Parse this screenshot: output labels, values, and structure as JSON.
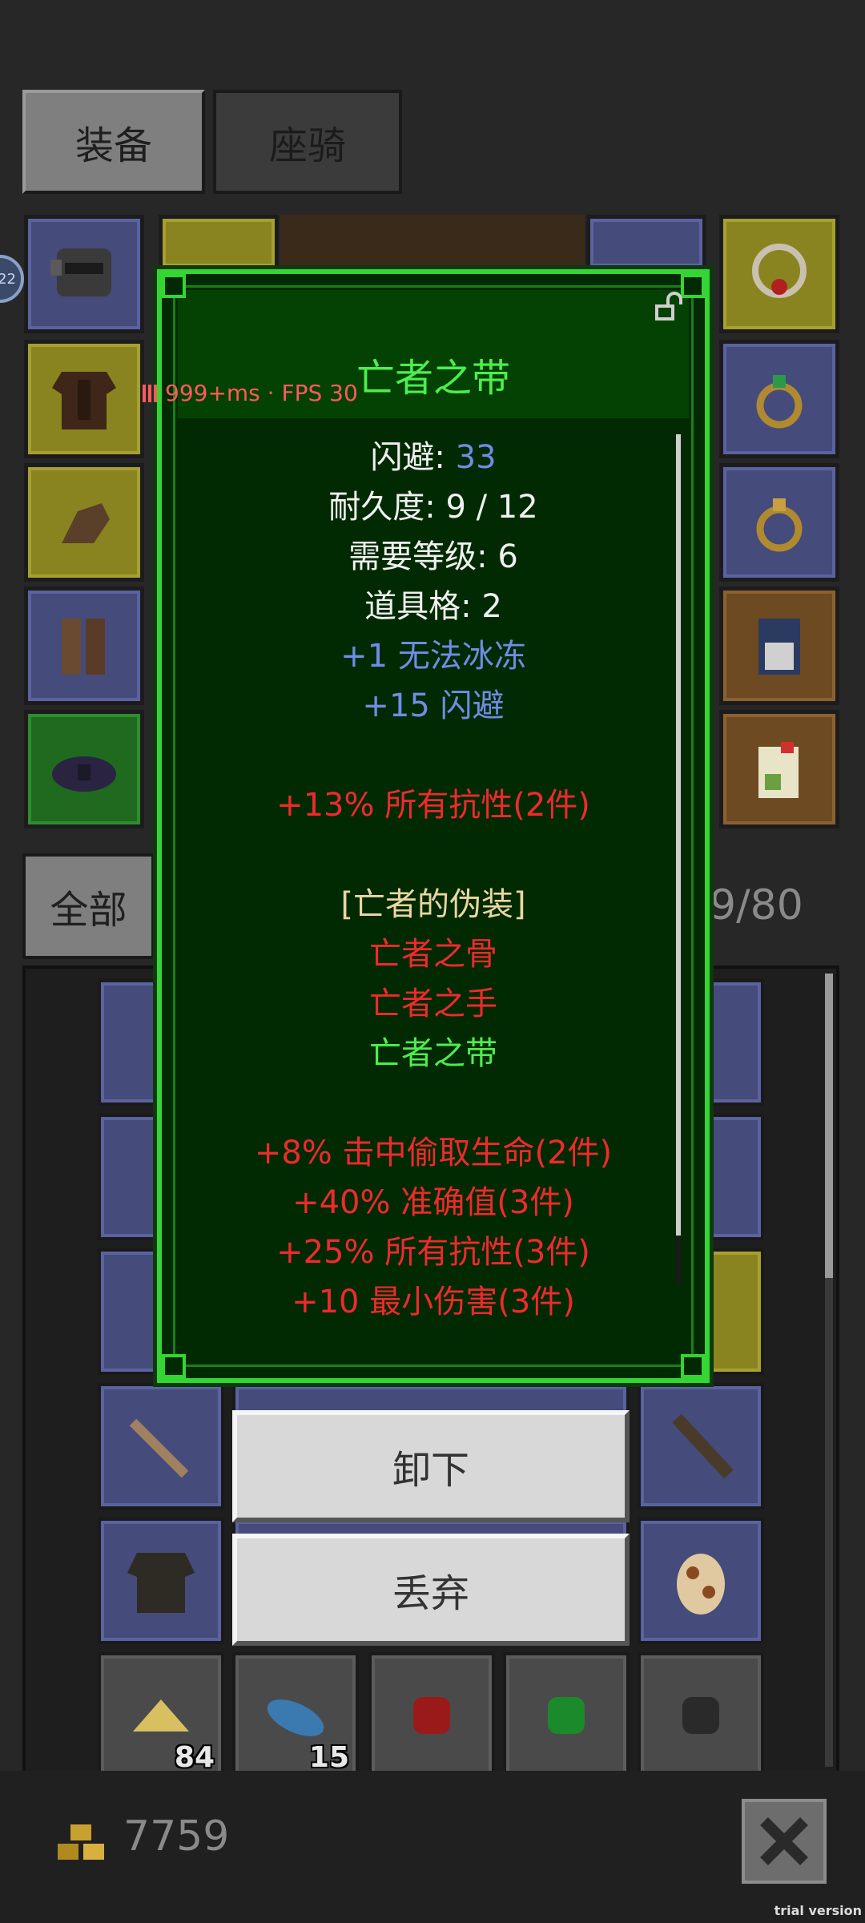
{
  "tabs": {
    "equipment": "装备",
    "mount": "座骑"
  },
  "status": {
    "fps_text": "999+ms · FPS 30"
  },
  "level_badge": "22",
  "tooltip": {
    "title": "亡者之带",
    "dodge_label": "闪避: ",
    "dodge_value": "33",
    "durability": "耐久度: 9 / 12",
    "required_level": "需要等级: 6",
    "item_slots": "道具格: 2",
    "bonus1": "+1 无法冰冻",
    "bonus2": "+15 闪避",
    "set_bonus_a": "+13% 所有抗性(2件)",
    "set_name": "[亡者的伪装]",
    "set_item1": "亡者之骨",
    "set_item2": "亡者之手",
    "set_item3": "亡者之带",
    "set_bonus1": "+8% 击中偷取生命(2件)",
    "set_bonus2": "+40% 准确值(3件)",
    "set_bonus3": "+25% 所有抗性(3件)",
    "set_bonus4": "+10 最小伤害(3件)"
  },
  "actions": {
    "unequip": "卸下",
    "discard": "丢弃"
  },
  "inventory": {
    "filter_all": "全部",
    "capacity": "9/80",
    "counts": [
      "84",
      "15"
    ]
  },
  "footer": {
    "gold": "7759",
    "trial": "trial version"
  },
  "colors": {
    "tooltip_border": "#33d633",
    "title_green": "#4dee4d",
    "bonus_blue": "#6f8ce6",
    "set_red": "#ee2a2a"
  }
}
